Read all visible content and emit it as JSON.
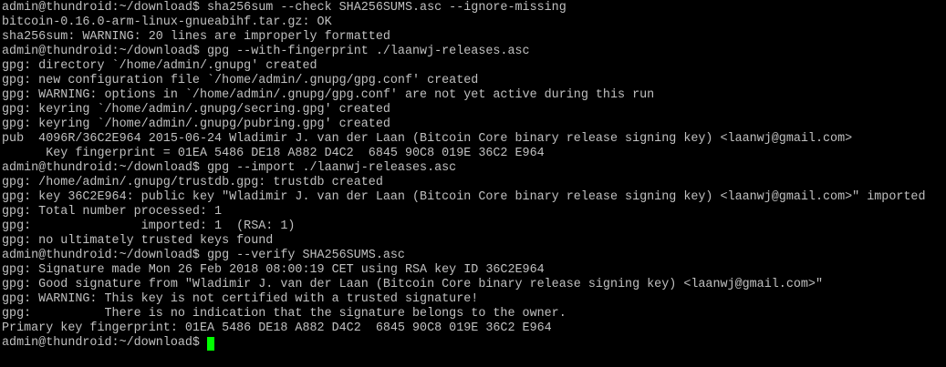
{
  "terminal": {
    "background_color": "#000000",
    "text_color": "#c0c0c0",
    "cursor_color": "#00ff00",
    "lines": [
      "admin@thundroid:~/download$ sha256sum --check SHA256SUMS.asc --ignore-missing",
      "bitcoin-0.16.0-arm-linux-gnueabihf.tar.gz: OK",
      "sha256sum: WARNING: 20 lines are improperly formatted",
      "admin@thundroid:~/download$ gpg --with-fingerprint ./laanwj-releases.asc",
      "gpg: directory `/home/admin/.gnupg' created",
      "gpg: new configuration file `/home/admin/.gnupg/gpg.conf' created",
      "gpg: WARNING: options in `/home/admin/.gnupg/gpg.conf' are not yet active during this run",
      "gpg: keyring `/home/admin/.gnupg/secring.gpg' created",
      "gpg: keyring `/home/admin/.gnupg/pubring.gpg' created",
      "pub  4096R/36C2E964 2015-06-24 Wladimir J. van der Laan (Bitcoin Core binary release signing key) <laanwj@gmail.com>",
      "      Key fingerprint = 01EA 5486 DE18 A882 D4C2  6845 90C8 019E 36C2 E964",
      "admin@thundroid:~/download$ gpg --import ./laanwj-releases.asc",
      "gpg: /home/admin/.gnupg/trustdb.gpg: trustdb created",
      "gpg: key 36C2E964: public key \"Wladimir J. van der Laan (Bitcoin Core binary release signing key) <laanwj@gmail.com>\" imported",
      "gpg: Total number processed: 1",
      "gpg:               imported: 1  (RSA: 1)",
      "gpg: no ultimately trusted keys found",
      "admin@thundroid:~/download$ gpg --verify SHA256SUMS.asc",
      "gpg: Signature made Mon 26 Feb 2018 08:00:19 CET using RSA key ID 36C2E964",
      "gpg: Good signature from \"Wladimir J. van der Laan (Bitcoin Core binary release signing key) <laanwj@gmail.com>\"",
      "gpg: WARNING: This key is not certified with a trusted signature!",
      "gpg:          There is no indication that the signature belongs to the owner.",
      "Primary key fingerprint: 01EA 5486 DE18 A882 D4C2  6845 90C8 019E 36C2 E964"
    ],
    "prompt": "admin@thundroid:~/download$"
  }
}
